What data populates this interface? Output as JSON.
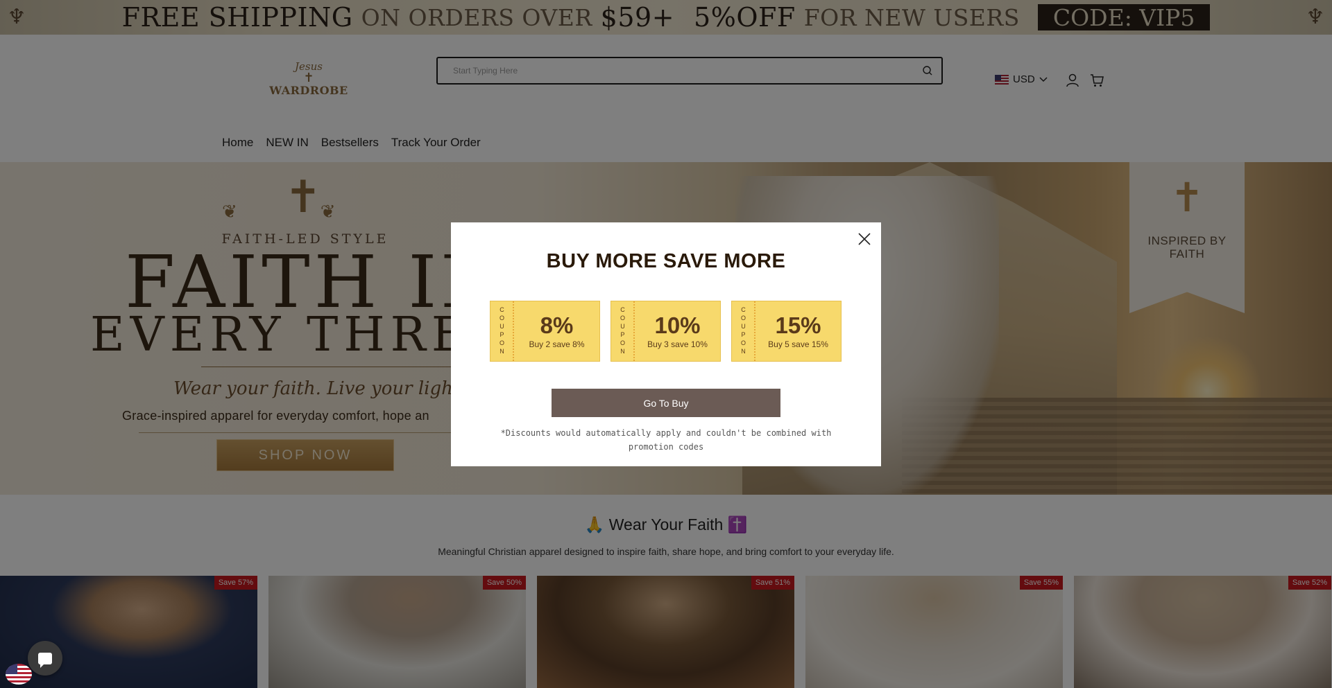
{
  "announcement": {
    "free_shipping": "FREE SHIPPING",
    "on_orders_over": "ON ORDERS OVER",
    "threshold": "$59+",
    "discount": "5%OFF",
    "for_new_users": "FOR NEW USERS",
    "code": "CODE: VIP5"
  },
  "header": {
    "logo_top": "Jesus",
    "logo_bottom": "WARDROBE",
    "search_placeholder": "Start Typing Here",
    "currency": "USD",
    "nav": [
      "Home",
      "NEW IN",
      "Bestsellers",
      "Track Your Order"
    ]
  },
  "hero": {
    "tagline": "FAITH-LED STYLE",
    "title_line1": "FAITH IN",
    "title_line2": "EVERY THREA",
    "script": "Wear your faith. Live your light.",
    "subtitle": "Grace-inspired apparel for everyday comfort, hope an",
    "cta": "SHOP NOW",
    "badge": "INSPIRED BY FAITH"
  },
  "section": {
    "title": "🙏 Wear Your Faith ✝️",
    "subtitle": "Meaningful Christian apparel designed to inspire faith, share hope, and bring comfort to your everyday life."
  },
  "products": [
    {
      "save": "Save 57%"
    },
    {
      "save": "Save 50%"
    },
    {
      "save": "Save 51%"
    },
    {
      "save": "Save 55%"
    },
    {
      "save": "Save 52%"
    }
  ],
  "modal": {
    "title": "BUY MORE SAVE MORE",
    "coupon_side": "COUPON",
    "coupons": [
      {
        "percent": "8%",
        "desc": "Buy 2 save 8%"
      },
      {
        "percent": "10%",
        "desc": "Buy 3 save 10%"
      },
      {
        "percent": "15%",
        "desc": "Buy 5 save 15%"
      }
    ],
    "button": "Go To Buy",
    "disclaimer": "*Discounts would automatically apply and couldn't be combined with promotion codes"
  },
  "icons": {
    "search": "search-icon",
    "user": "user-icon",
    "cart": "cart-icon",
    "close": "close-icon",
    "chat": "chat-icon"
  },
  "colors": {
    "coupon_bg": "#f7d96c",
    "button_bg": "#6b5b55",
    "save_badge": "#c8191e",
    "accent_gold": "#8b6a3e"
  }
}
